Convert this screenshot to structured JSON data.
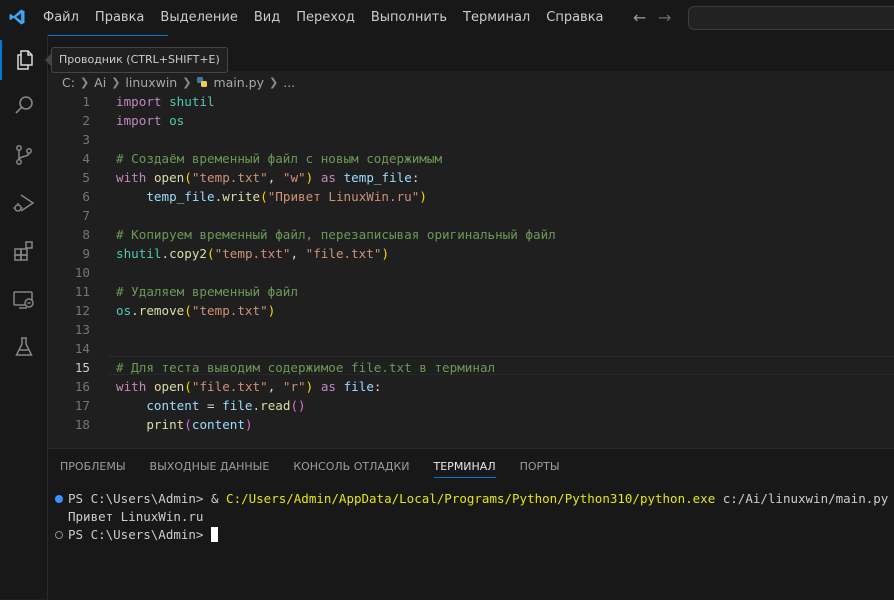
{
  "menu": [
    "Файл",
    "Правка",
    "Выделение",
    "Вид",
    "Переход",
    "Выполнить",
    "Терминал",
    "Справка"
  ],
  "nav": {
    "back": "←",
    "forward": "→"
  },
  "tooltip": "Проводник (CTRL+SHIFT+E)",
  "breadcrumb": {
    "drive": "C:",
    "folder1": "Ai",
    "folder2": "linuxwin",
    "file": "main.py",
    "more": "..."
  },
  "editor": {
    "current_line": 15,
    "lines": [
      {
        "n": "1"
      },
      {
        "n": "2"
      },
      {
        "n": "3"
      },
      {
        "n": "4"
      },
      {
        "n": "5"
      },
      {
        "n": "6"
      },
      {
        "n": "7"
      },
      {
        "n": "8"
      },
      {
        "n": "9"
      },
      {
        "n": "10"
      },
      {
        "n": "11"
      },
      {
        "n": "12"
      },
      {
        "n": "13"
      },
      {
        "n": "14"
      },
      {
        "n": "15"
      },
      {
        "n": "16"
      },
      {
        "n": "17"
      },
      {
        "n": "18"
      }
    ],
    "tokens": {
      "l1": [
        "import",
        " ",
        "shutil"
      ],
      "l2": [
        "import",
        " ",
        "os"
      ],
      "l4": [
        "# Создаём временный файл с новым содержимым"
      ],
      "l5": [
        "with",
        " ",
        "open",
        "(",
        "\"temp.txt\"",
        ", ",
        "\"w\"",
        ")",
        " ",
        "as",
        " ",
        "temp_file",
        ":"
      ],
      "l6": [
        "    ",
        "temp_file",
        ".",
        "write",
        "(",
        "\"Привет LinuxWin.ru\"",
        ")"
      ],
      "l8": [
        "# Копируем временный файл, перезаписывая оригинальный файл"
      ],
      "l9": [
        "shutil",
        ".",
        "copy2",
        "(",
        "\"temp.txt\"",
        ", ",
        "\"file.txt\"",
        ")"
      ],
      "l11": [
        "# Удаляем временный файл"
      ],
      "l12": [
        "os",
        ".",
        "remove",
        "(",
        "\"temp.txt\"",
        ")"
      ],
      "l15": [
        "# Для теста выводим содержимое file.txt в терминал"
      ],
      "l16": [
        "with",
        " ",
        "open",
        "(",
        "\"file.txt\"",
        ", ",
        "\"r\"",
        ")",
        " ",
        "as",
        " ",
        "file",
        ":"
      ],
      "l17": [
        "    ",
        "content",
        " = ",
        "file",
        ".",
        "read",
        "()"
      ],
      "l18": [
        "    ",
        "print",
        "(",
        "content",
        ")"
      ]
    }
  },
  "panel": {
    "tabs": [
      "ПРОБЛЕМЫ",
      "ВЫХОДНЫЕ ДАННЫЕ",
      "КОНСОЛЬ ОТЛАДКИ",
      "ТЕРМИНАЛ",
      "ПОРТЫ"
    ],
    "active_tab": "ТЕРМИНАЛ"
  },
  "terminal": {
    "line1_prompt": "PS C:\\Users\\Admin> & ",
    "line1_exe": "C:/Users/Admin/AppData/Local/Programs/Python/Python310/python.exe",
    "line1_arg": " c:/Ai/linuxwin/main.py",
    "line2": "Привет LinuxWin.ru",
    "line3_prompt": "PS C:\\Users\\Admin> "
  },
  "colors": {
    "accent": "#0078d4",
    "keyword": "#c586c0",
    "string": "#ce9178",
    "comment": "#6a9955",
    "function": "#dcdcaa",
    "variable": "#9cdcfe"
  }
}
